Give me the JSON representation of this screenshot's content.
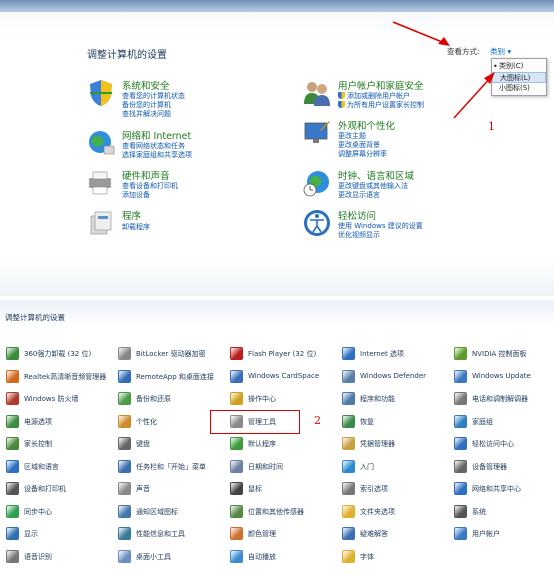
{
  "top": {
    "title": "调整计算机的设置",
    "view_by_label": "查看方式:",
    "view_by_value": "类别 ▾",
    "view_menu": [
      "类别(C)",
      "大图标(L)",
      "小图标(S)"
    ],
    "categories_left": [
      {
        "title": "系统和安全",
        "links": [
          "查看您的计算机状态",
          "备份您的计算机",
          "查找并解决问题"
        ],
        "icon": "system-security-icon"
      },
      {
        "title": "网络和 Internet",
        "links": [
          "查看网络状态和任务",
          "选择家庭组和共享选项"
        ],
        "icon": "network-icon"
      },
      {
        "title": "硬件和声音",
        "links": [
          "查看设备和打印机",
          "添加设备"
        ],
        "icon": "hardware-sound-icon"
      },
      {
        "title": "程序",
        "links": [
          "卸载程序"
        ],
        "icon": "programs-icon"
      }
    ],
    "categories_right": [
      {
        "title": "用户帐户和家庭安全",
        "links": [
          "添加或删除用户帐户",
          "为所有用户设置家长控制"
        ],
        "shield": [
          true,
          true
        ],
        "icon": "user-accounts-icon"
      },
      {
        "title": "外观和个性化",
        "links": [
          "更改主题",
          "更改桌面背景",
          "调整屏幕分辨率"
        ],
        "shield": [
          false,
          false,
          false
        ],
        "icon": "appearance-icon"
      },
      {
        "title": "时钟、语言和区域",
        "links": [
          "更改键盘或其他输入法",
          "更改显示语言"
        ],
        "shield": [
          false,
          false
        ],
        "icon": "clock-language-icon"
      },
      {
        "title": "轻松访问",
        "links": [
          "使用 Windows 建议的设置",
          "优化视频显示"
        ],
        "shield": [
          false,
          false
        ],
        "icon": "ease-of-access-icon"
      }
    ]
  },
  "bottom": {
    "title": "调整计算机的设置",
    "columns": [
      [
        "360强力卸载 (32 位)",
        "Realtek高清晰音频管理器",
        "Windows 防火墙",
        "电源选项",
        "家长控制",
        "区域和语言",
        "设备和打印机",
        "同步中心",
        "显示",
        "语音识别"
      ],
      [
        "BitLocker 驱动器加密",
        "RemoteApp 和桌面连接",
        "备份和还原",
        "个性化",
        "键盘",
        "任务栏和「开始」菜单",
        "声音",
        "通知区域图标",
        "性能信息和工具",
        "桌面小工具"
      ],
      [
        "Flash Player (32 位)",
        "Windows CardSpace",
        "操作中心",
        "管理工具",
        "默认程序",
        "日期和时间",
        "鼠标",
        "位置和其他传感器",
        "颜色管理",
        "自动播放"
      ],
      [
        "Internet 选项",
        "Windows Defender",
        "程序和功能",
        "恢复",
        "凭据管理器",
        "入门",
        "索引选项",
        "文件夹选项",
        "疑难解答",
        "字体"
      ],
      [
        "NVIDIA 控制面板",
        "Windows Update",
        "电话和调制解调器",
        "家庭组",
        "轻松访问中心",
        "设备管理器",
        "网络和共享中心",
        "系统",
        "用户帐户",
        ""
      ]
    ],
    "icon_colors": [
      [
        "#3a8d3a",
        "#d2691e",
        "#b03a2e",
        "#3c8d3c",
        "#4b8b3b",
        "#2e6fbf",
        "#555555",
        "#2e9e4f",
        "#3070b0",
        "#777777"
      ],
      [
        "#888888",
        "#2f6db5",
        "#4a9a4a",
        "#d08a2a",
        "#666666",
        "#3b6fb0",
        "#888888",
        "#4477aa",
        "#3a7a9a",
        "#6a8fc0"
      ],
      [
        "#b81e1e",
        "#3a6fb8",
        "#d0a020",
        "#8a8a8a",
        "#3c9a3c",
        "#6b7fa0",
        "#444444",
        "#558844",
        "#d07030",
        "#3d8bd0"
      ],
      [
        "#2e6fbf",
        "#5a7fa8",
        "#4a7aa8",
        "#3a8a4a",
        "#c7a040",
        "#2e8ad0",
        "#777777",
        "#e0b030",
        "#3a70b0",
        "#e0b030"
      ],
      [
        "#5a9a2a",
        "#3a78c0",
        "#777777",
        "#2e7fbf",
        "#2e6fbf",
        "#666666",
        "#2e6fbf",
        "#555555",
        "#3a78c0",
        "#ffffff"
      ]
    ],
    "annotation_1": "1",
    "annotation_2": "2"
  }
}
